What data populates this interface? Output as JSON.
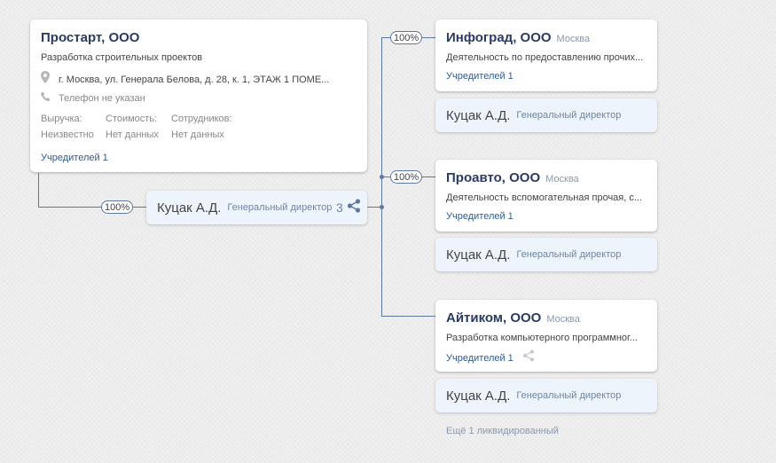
{
  "main_company": {
    "name": "Простарт, ООО",
    "activity": "Разработка строительных проектов",
    "address": "г. Москва, ул. Генерала Белова, д. 28, к. 1, ЭТАЖ 1 ПОМЕ...",
    "phone": "Телефон не указан",
    "revenue_label": "Выручка:",
    "revenue_value": "Неизвестно",
    "cost_label": "Стоимость:",
    "cost_value": "Нет данных",
    "employees_label": "Сотрудников:",
    "employees_value": "Нет данных",
    "founders_link": "Учредителей 1"
  },
  "connector": {
    "share": "100%",
    "person_name": "Куцак А.Д.",
    "person_role": "Генеральный директор",
    "count": "3"
  },
  "related": [
    {
      "share": "100%",
      "name": "Инфоград, ООО",
      "city": "Москва",
      "activity": "Деятельность по предоставлению прочих...",
      "founders_link": "Учредителей 1",
      "person_name": "Куцак А.Д.",
      "person_role": "Генеральный директор"
    },
    {
      "share": "100%",
      "name": "Проавто, ООО",
      "city": "Москва",
      "activity": "Деятельность вспомогательная прочая, с...",
      "founders_link": "Учредителей 1",
      "person_name": "Куцак А.Д.",
      "person_role": "Генеральный директор"
    },
    {
      "name": "Айтиком, ООО",
      "city": "Москва",
      "activity": "Разработка компьютерного программног...",
      "founders_link": "Учредителей 1",
      "person_name": "Куцак А.Д.",
      "person_role": "Генеральный директор"
    }
  ],
  "liquidated_note": "Ещё 1 ликвидированный",
  "colors": {
    "line": "#5f78a3",
    "title": "#2a3b63",
    "link": "#2f5a93",
    "person_bg": "#eef4fc"
  },
  "icons": [
    "location-pin-icon",
    "phone-icon",
    "share-icon"
  ]
}
